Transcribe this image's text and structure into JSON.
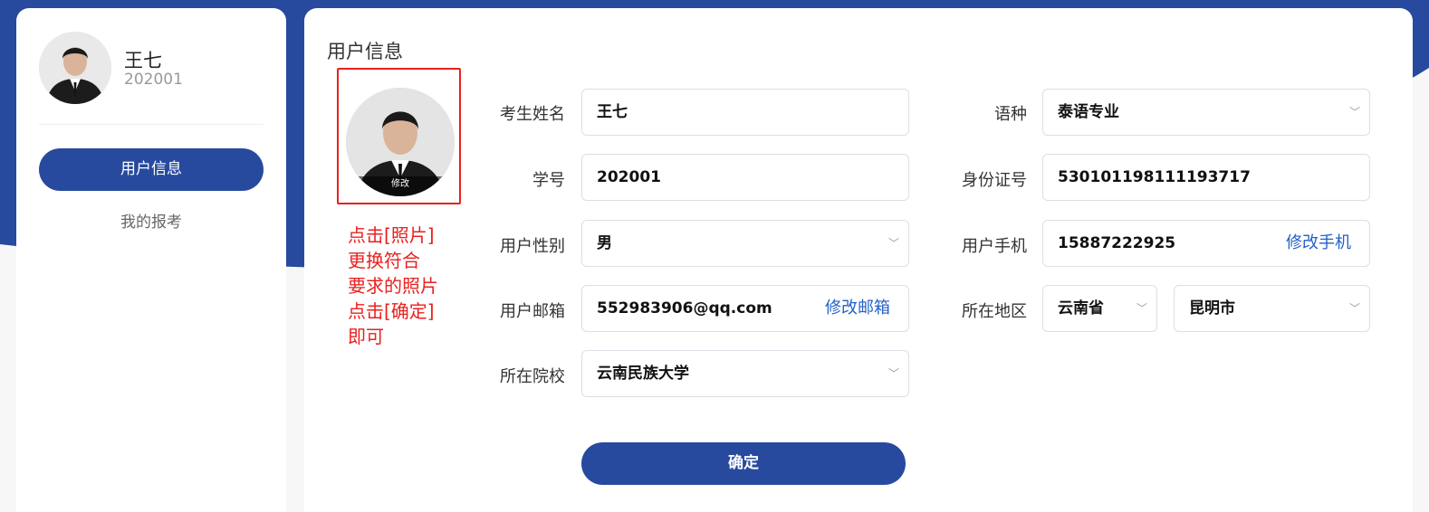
{
  "colors": {
    "primary": "#274a9e",
    "alert": "#e8211f",
    "link": "#2460c6"
  },
  "sidebar": {
    "profile": {
      "name": "王七",
      "id": "202001"
    },
    "nav": [
      {
        "label": "用户信息",
        "active": true
      },
      {
        "label": "我的报考",
        "active": false
      }
    ]
  },
  "main": {
    "title": "用户信息",
    "photo": {
      "edit_label": "修改"
    },
    "tip_lines": [
      "点击[照片]",
      "更换符合",
      "要求的照片",
      "点击[确定]",
      "即可"
    ],
    "fields": {
      "name": {
        "label": "考生姓名",
        "value": "王七"
      },
      "student_id": {
        "label": "学号",
        "value": "202001"
      },
      "gender": {
        "label": "用户性别",
        "value": "男"
      },
      "email": {
        "label": "用户邮箱",
        "value": "552983906@qq.com",
        "action": "修改邮箱"
      },
      "school": {
        "label": "所在院校",
        "value": "云南民族大学"
      },
      "language": {
        "label": "语种",
        "value": "泰语专业"
      },
      "id_card": {
        "label": "身份证号",
        "value": "530101198111193717"
      },
      "phone": {
        "label": "用户手机",
        "value": "15887222925",
        "action": "修改手机"
      },
      "region": {
        "label": "所在地区",
        "province": "云南省",
        "city": "昆明市"
      }
    },
    "submit_label": "确定"
  },
  "icons": {
    "dropdown": "chevron-down-icon"
  }
}
